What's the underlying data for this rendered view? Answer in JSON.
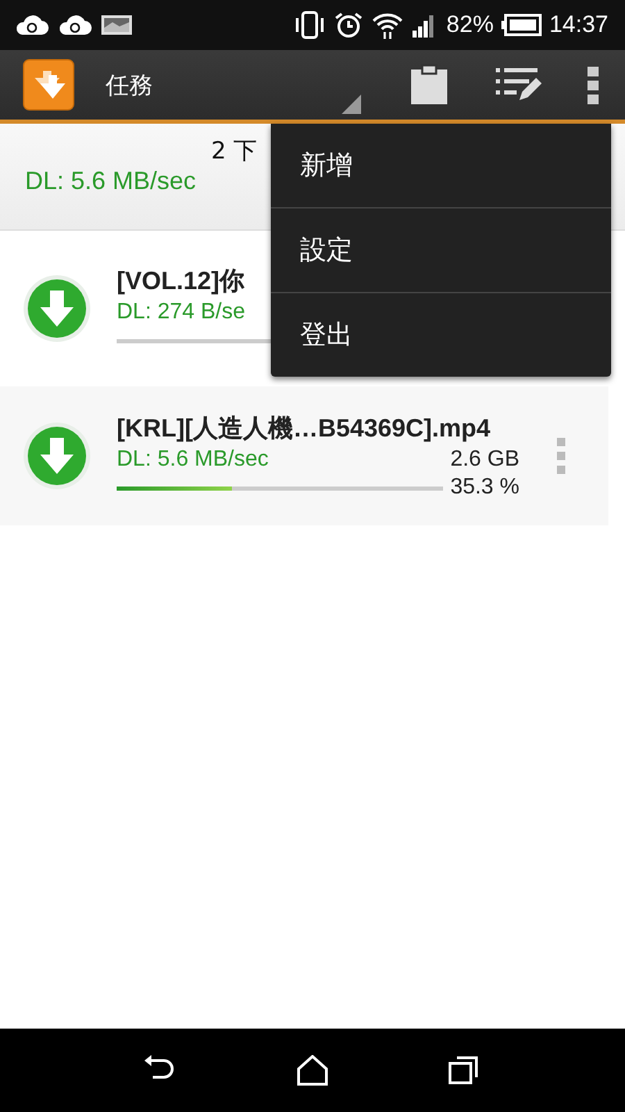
{
  "status_bar": {
    "battery": "82%",
    "time": "14:37"
  },
  "action_bar": {
    "title": "任務"
  },
  "summary": {
    "count": "2 下",
    "speed": "DL: 5.6 MB/sec"
  },
  "downloads": [
    {
      "name": "[VOL.12]你",
      "speed": "DL: 274 B/se",
      "menu_visible": false
    },
    {
      "name": "[KRL][人造人機…B54369C].mp4",
      "speed": "DL: 5.6 MB/sec",
      "level": 0.353,
      "size": "2.6 GB",
      "percent": "35.3 %",
      "menu_visible": true
    }
  ],
  "overflow_menu": {
    "items": [
      {
        "label": "新增"
      },
      {
        "label": "設定"
      },
      {
        "label": "登出"
      }
    ]
  }
}
